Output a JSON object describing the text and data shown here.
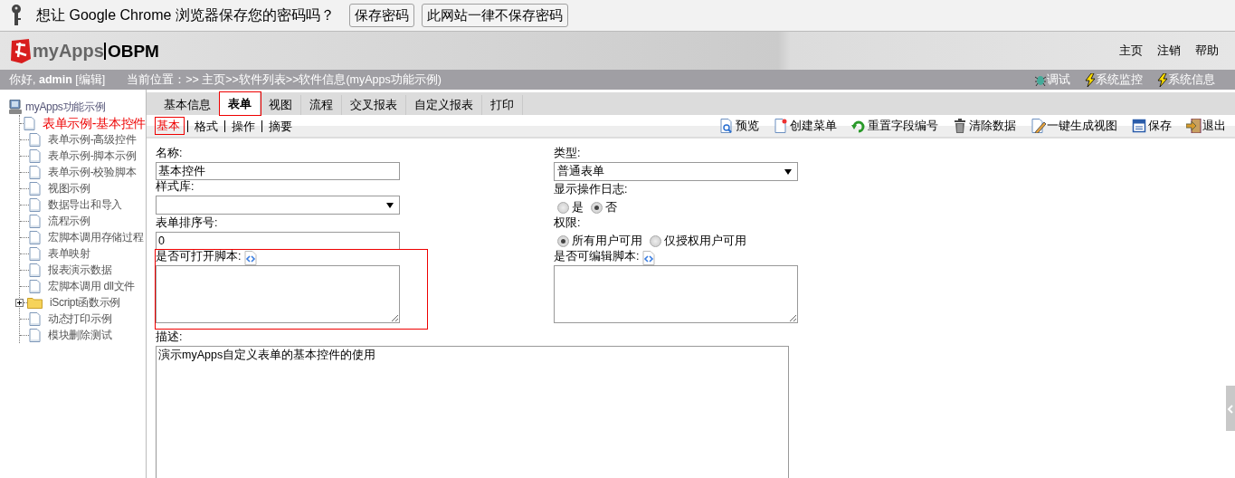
{
  "password_bar": {
    "message": "想让 Google Chrome 浏览器保存您的密码吗？",
    "buttons": [
      "保存密码",
      "此网站一律不保存密码"
    ]
  },
  "header": {
    "logo_name": "myApps",
    "logo_product": "OBPM",
    "links": [
      "主页",
      "注销",
      "帮助"
    ]
  },
  "info_bar": {
    "greeting": "你好, **admin** [编辑]",
    "location": "当前位置：>> 主页>>软件列表>>软件信息(myApps功能示例)",
    "tools": [
      "调试",
      "系统监控",
      "系统信息"
    ]
  },
  "tree": {
    "label": "myApps功能示例",
    "children": [
      {
        "label": "表单示例-基本控件",
        "kind": "page",
        "selected": true
      },
      {
        "label": "表单示例-高级控件",
        "kind": "page",
        "selected": false
      },
      {
        "label": "表单示例-脚本示例",
        "kind": "page",
        "selected": false
      },
      {
        "label": "表单示例-校验脚本",
        "kind": "page",
        "selected": false
      },
      {
        "label": "视图示例",
        "kind": "page",
        "selected": false
      },
      {
        "label": "数据导出和导入",
        "kind": "page",
        "selected": false
      },
      {
        "label": "流程示例",
        "kind": "page",
        "selected": false
      },
      {
        "label": "宏脚本调用存储过程",
        "kind": "page",
        "selected": false
      },
      {
        "label": "表单映射",
        "kind": "page",
        "selected": false
      },
      {
        "label": "报表演示数据",
        "kind": "page",
        "selected": false
      },
      {
        "label": "宏脚本调用 dll文件",
        "kind": "page",
        "selected": false
      },
      {
        "label": "iScript函数示例",
        "kind": "folder",
        "expanded": false,
        "selected": false
      },
      {
        "label": "动态打印示例",
        "kind": "page",
        "selected": false
      },
      {
        "label": "模块删除测试",
        "kind": "page",
        "selected": false
      }
    ]
  },
  "tabs": [
    {
      "label": "基本信息",
      "selected": false
    },
    {
      "label": "表单",
      "selected": true
    },
    {
      "label": "视图",
      "selected": false
    },
    {
      "label": "流程",
      "selected": false
    },
    {
      "label": "交叉报表",
      "selected": false
    },
    {
      "label": "自定义报表",
      "selected": false
    },
    {
      "label": "打印",
      "selected": false
    }
  ],
  "subtabs": [
    {
      "label": "基本",
      "selected": true
    },
    {
      "label": "格式",
      "selected": false
    },
    {
      "label": "操作",
      "selected": false
    },
    {
      "label": "摘要",
      "selected": false
    }
  ],
  "toolbar": [
    "预览",
    "创建菜单",
    "重置字段编号",
    "清除数据",
    "一键生成视图",
    "保存",
    "退出"
  ],
  "form": {
    "left_fields": [
      {
        "label": "名称:",
        "kind": "text",
        "value": "基本控件"
      },
      {
        "label": "样式库:",
        "kind": "select"
      },
      {
        "label": "表单排序号:",
        "kind": "text",
        "value": "0"
      },
      {
        "label": "是否可打开脚本:",
        "kind": "textarea",
        "script_icon": true,
        "highlighted": true
      }
    ],
    "right_fields": [
      {
        "label": "类型:",
        "kind": "select",
        "value": "普通表单"
      },
      {
        "label": "显示操作日志:",
        "kind": "radio",
        "options": [
          {
            "label": "是",
            "selected": false
          },
          {
            "label": "否",
            "selected": true
          }
        ]
      },
      {
        "label": "权限:",
        "kind": "radio",
        "options": [
          {
            "label": "所有用户可用",
            "selected": true
          },
          {
            "label": "仅授权用户可用",
            "selected": false
          }
        ]
      },
      {
        "label": "是否可编辑脚本:",
        "kind": "textarea",
        "script_icon": true
      }
    ],
    "description": {
      "label": "描述:",
      "value": "演示myApps自定义表单的基本控件的使用"
    }
  }
}
